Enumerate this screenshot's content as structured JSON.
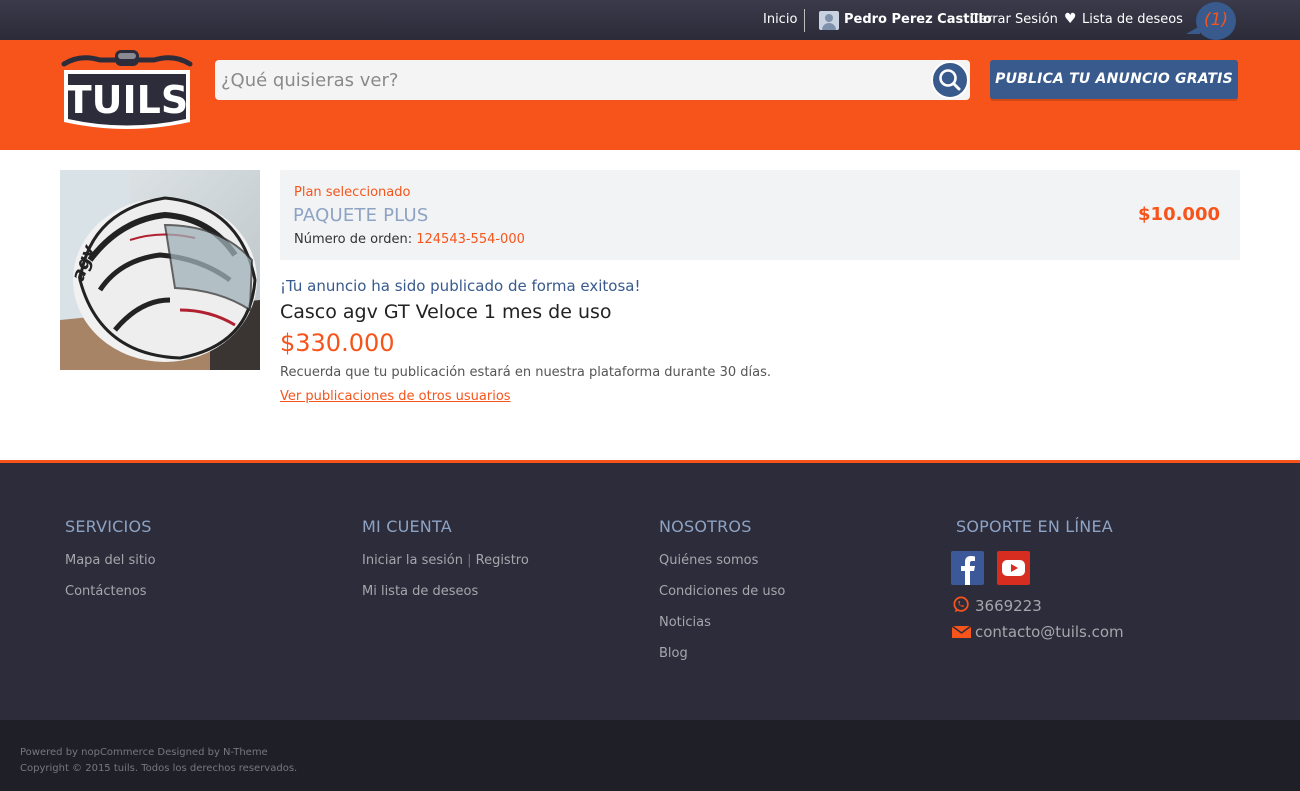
{
  "topbar": {
    "home": "Inicio",
    "user_name": "Pedro Perez Castillo",
    "logout": "Cerrar Sesión",
    "wishlist": "Lista de deseos",
    "wishlist_count": "(1)"
  },
  "header": {
    "logo_text": "TUILS",
    "search_placeholder": "¿Qué quisieras ver?",
    "publish_button": "PUBLICA TU ANUNCIO GRATIS"
  },
  "plan": {
    "label": "Plan seleccionado",
    "name": "PAQUETE PLUS",
    "order_label": "Número de orden:",
    "order_number": "124543-554-000",
    "price": "$10.000"
  },
  "listing": {
    "success_message": "¡Tu anuncio ha sido publicado de forma exitosa!",
    "title": "Casco agv GT Veloce 1 mes de uso",
    "price": "$330.000",
    "reminder": "Recuerda que tu publicación estará en nuestra plataforma durante 30 días.",
    "other_link": "Ver publicaciones de otros usuarios",
    "image_brand_text": "agv"
  },
  "footer": {
    "col1": {
      "title": "SERVICIOS",
      "links": [
        "Mapa del sitio",
        "Contáctenos"
      ]
    },
    "col2": {
      "title": "MI CUENTA",
      "login": "Iniciar la sesión",
      "sep": "|",
      "register": "Registro",
      "links": [
        "Mi lista de deseos"
      ]
    },
    "col3": {
      "title": "NOSOTROS",
      "links": [
        "Quiénes somos",
        "Condiciones de uso",
        "Noticias",
        "Blog"
      ]
    },
    "col4": {
      "title": "SOPORTE EN LÍNEA",
      "phone": "3669223",
      "email": "contacto@tuils.com"
    },
    "powered": "Powered by nopCommerce Designed by N-Theme",
    "copyright": "Copyright © 2015 tuils. Todos los derechos reservados."
  },
  "colors": {
    "accent": "#f7541b",
    "navy": "#385a8c",
    "footer_bg": "#2c2c3a"
  }
}
